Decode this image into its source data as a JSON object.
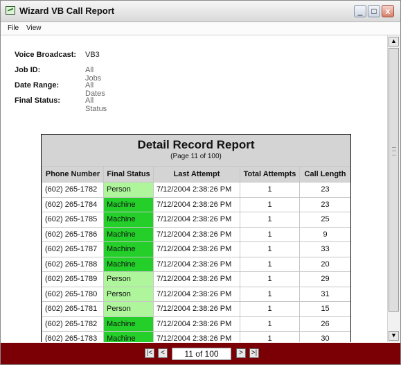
{
  "window": {
    "title": "Wizard VB Call Report",
    "minimize": "_",
    "maximize": "□",
    "close": "x"
  },
  "menu": [
    "File",
    "View"
  ],
  "summary": [
    {
      "label": "Voice Broadcast:",
      "value": "VB3"
    },
    {
      "label": "Job ID:",
      "value": "All Jobs"
    },
    {
      "label": "Date Range:",
      "value": "All Dates"
    },
    {
      "label": "Final Status:",
      "value": "All Status"
    }
  ],
  "report": {
    "title": "Detail Record Report",
    "subtitle": "(Page 11 of 100)",
    "columns": [
      "Phone Number",
      "Final Status",
      "Last Attempt",
      "Total Attempts",
      "Call Length"
    ],
    "rows": [
      {
        "phone": "(602) 265-1782",
        "status": "Person",
        "last_attempt": "7/12/2004 2:38:26 PM",
        "total_attempts": "1",
        "call_length": "23"
      },
      {
        "phone": "(602) 265-1784",
        "status": "Machine",
        "last_attempt": "7/12/2004 2:38:26 PM",
        "total_attempts": "1",
        "call_length": "23"
      },
      {
        "phone": "(602) 265-1785",
        "status": "Machine",
        "last_attempt": "7/12/2004 2:38:26 PM",
        "total_attempts": "1",
        "call_length": "25"
      },
      {
        "phone": "(602) 265-1786",
        "status": "Machine",
        "last_attempt": "7/12/2004 2:38:26 PM",
        "total_attempts": "1",
        "call_length": "9"
      },
      {
        "phone": "(602) 265-1787",
        "status": "Machine",
        "last_attempt": "7/12/2004 2:38:26 PM",
        "total_attempts": "1",
        "call_length": "33"
      },
      {
        "phone": "(602) 265-1788",
        "status": "Machine",
        "last_attempt": "7/12/2004 2:38:26 PM",
        "total_attempts": "1",
        "call_length": "20"
      },
      {
        "phone": "(602) 265-1789",
        "status": "Person",
        "last_attempt": "7/12/2004 2:38:26 PM",
        "total_attempts": "1",
        "call_length": "29"
      },
      {
        "phone": "(602) 265-1780",
        "status": "Person",
        "last_attempt": "7/12/2004 2:38:26 PM",
        "total_attempts": "1",
        "call_length": "31"
      },
      {
        "phone": "(602) 265-1781",
        "status": "Person",
        "last_attempt": "7/12/2004 2:38:26 PM",
        "total_attempts": "1",
        "call_length": "15"
      },
      {
        "phone": "(602) 265-1782",
        "status": "Machine",
        "last_attempt": "7/12/2004 2:38:26 PM",
        "total_attempts": "1",
        "call_length": "26"
      },
      {
        "phone": "(602) 265-1783",
        "status": "Machine",
        "last_attempt": "7/12/2004 2:38:26 PM",
        "total_attempts": "1",
        "call_length": "30"
      }
    ]
  },
  "pager": {
    "first": "|<",
    "prev": "<",
    "current": "11 of 100",
    "next": ">",
    "last": ">|"
  },
  "scrollbar": {
    "up": "▲",
    "down": "▼"
  },
  "colors": {
    "footer": "#7b0005",
    "person": "#aef59b",
    "machine": "#24cf2a"
  }
}
